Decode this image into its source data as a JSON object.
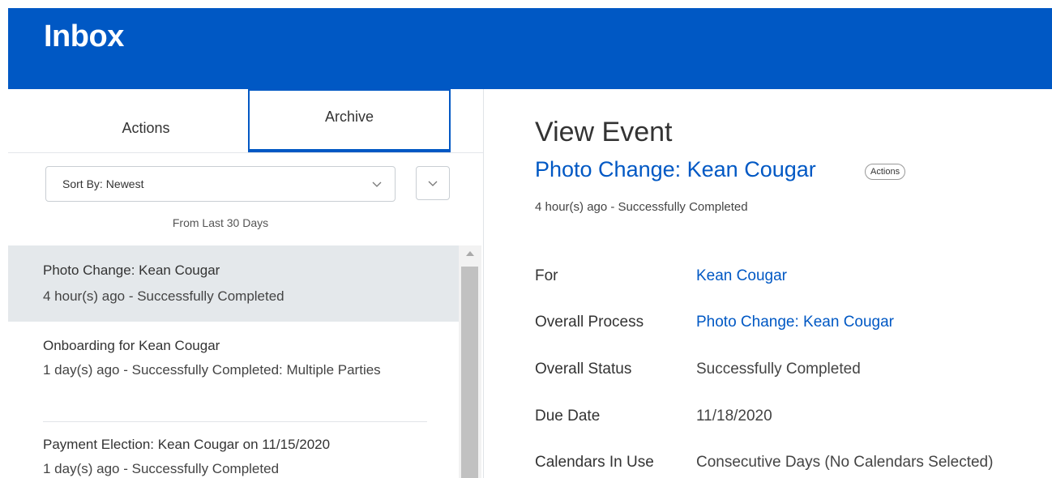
{
  "header": {
    "title": "Inbox"
  },
  "tabs": {
    "actions": "Actions",
    "archive": "Archive"
  },
  "sort": {
    "label": "Sort By:",
    "value": "Newest"
  },
  "range": "From Last 30 Days",
  "list": {
    "items": [
      {
        "title": "Photo Change: Kean Cougar",
        "sub": "4 hour(s) ago - Successfully Completed"
      },
      {
        "title": "Onboarding for Kean Cougar",
        "sub": "1 day(s) ago - Successfully Completed: Multiple Parties"
      },
      {
        "title": "Payment Election: Kean Cougar on 11/15/2020",
        "sub": "1 day(s) ago - Successfully Completed"
      }
    ]
  },
  "detail": {
    "heading": "View Event",
    "event_title": "Photo Change: Kean Cougar",
    "actions_label": "Actions",
    "status_line": "4 hour(s) ago - Successfully Completed",
    "fields": [
      {
        "label": "For",
        "value": "Kean Cougar"
      },
      {
        "label": "Overall Process",
        "value": "Photo Change: Kean Cougar"
      },
      {
        "label": "Overall Status",
        "value": "Successfully Completed"
      },
      {
        "label": "Due Date",
        "value": "11/18/2020"
      },
      {
        "label": "Calendars In Use",
        "value": "Consecutive Days (No Calendars Selected)"
      }
    ]
  },
  "colors": {
    "brand": "#0058c4",
    "selected_row": "#e4e8eb"
  },
  "icons": {
    "sort_chevron": "chevron-down-icon",
    "filter_chevron": "chevron-down-icon",
    "scroll_up": "arrow-up-icon"
  }
}
